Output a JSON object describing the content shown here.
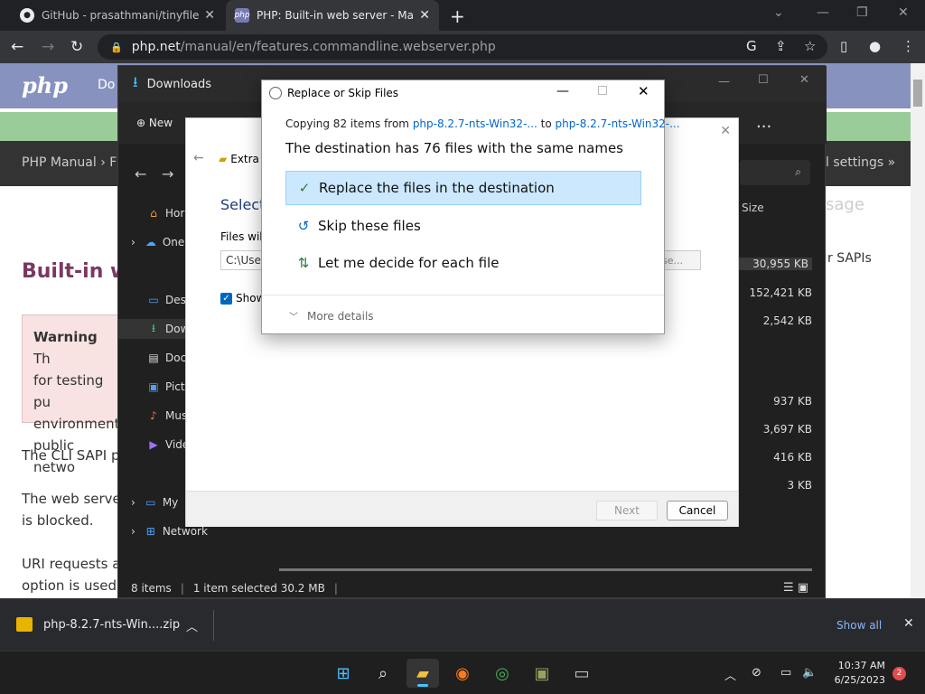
{
  "browser": {
    "tabs": [
      {
        "title": "GitHub - prasathmani/tinyfileman",
        "favicon": "github-icon"
      },
      {
        "title": "PHP: Built-in web server - Manua",
        "favicon": "php-icon",
        "active": true
      }
    ],
    "url_host": "php.net",
    "url_path": "/manual/en/features.commandline.webserver.php"
  },
  "php_page": {
    "logo": "php",
    "nav_partial": "Do",
    "breadcrumb": "PHP Manual",
    "breadcrumb_partial": "F",
    "settings_link": "l settings »",
    "sidebar_heading": "sage",
    "sidebar_link": "r SAPIs",
    "heading": "Built-in w",
    "warning_title": "Warning",
    "warning_lines": [
      "Th",
      "for testing pu",
      "environment",
      "public netwo"
    ],
    "para1": "The CLI SAPI pr",
    "para2_lines": [
      "The web server",
      "is blocked."
    ],
    "para3_lines": [
      "URI requests a",
      "option is used"
    ]
  },
  "explorer": {
    "title": "Downloads",
    "new_label": "New",
    "more_label": "...",
    "search_icon": "search-icon",
    "sidebar": [
      {
        "label": "Hor",
        "icon": "home-icon"
      },
      {
        "label": "One",
        "icon": "onedrive-icon",
        "expandable": true
      },
      {
        "label": "Desl",
        "icon": "desktop-icon"
      },
      {
        "label": "Dow",
        "icon": "downloads-icon",
        "selected": true
      },
      {
        "label": "Doc",
        "icon": "documents-icon"
      },
      {
        "label": "Pict",
        "icon": "pictures-icon"
      },
      {
        "label": "Mus",
        "icon": "music-icon"
      },
      {
        "label": "Vide",
        "icon": "videos-icon"
      },
      {
        "label": "My",
        "icon": "this-pc-icon",
        "expandable": true
      },
      {
        "label": "Network",
        "icon": "network-icon",
        "expandable": true
      }
    ],
    "size_header": "Size",
    "sizes": [
      "30,955 KB",
      "152,421 KB",
      "2,542 KB",
      "",
      "937 KB",
      "3,697 KB",
      "416 KB",
      "3 KB"
    ],
    "status": {
      "items": "8 items",
      "selected": "1 item selected  30.2 MB"
    }
  },
  "wizard": {
    "title": "Extra",
    "select_heading": "Select",
    "files_label": "Files will",
    "path_value": "C:\\User",
    "browse_label": "se...",
    "show_label": "Show",
    "next_label": "Next",
    "cancel_label": "Cancel"
  },
  "replace_dialog": {
    "title": "Replace or Skip Files",
    "copying_prefix": "Copying 82 items from ",
    "source": "php-8.2.7-nts-Win32-...",
    "copying_to": " to ",
    "dest": "php-8.2.7-nts-Win32-...",
    "heading": "The destination has 76 files with the same names",
    "options": [
      {
        "label": "Replace the files in the destination",
        "icon": "check-icon",
        "selected": true
      },
      {
        "label": "Skip these files",
        "icon": "skip-icon"
      },
      {
        "label": "Let me decide for each file",
        "icon": "decide-icon"
      }
    ],
    "more_details": "More details"
  },
  "downloads_bar": {
    "file": "php-8.2.7-nts-Win....zip",
    "show_all": "Show all"
  },
  "taskbar": {
    "time": "10:37 AM",
    "date": "6/25/2023",
    "notification_count": "2",
    "apps": [
      "windows-start-icon",
      "search-icon",
      "file-explorer-icon",
      "firefox-icon",
      "chrome-icon",
      "archive-app-icon",
      "terminal-icon"
    ]
  },
  "colors": {
    "php_purple": "#8892bf",
    "php_green": "#99cc99",
    "selection_blue": "#cce8ff",
    "link_blue": "#0066cc",
    "accent": "#4cc2ff"
  }
}
